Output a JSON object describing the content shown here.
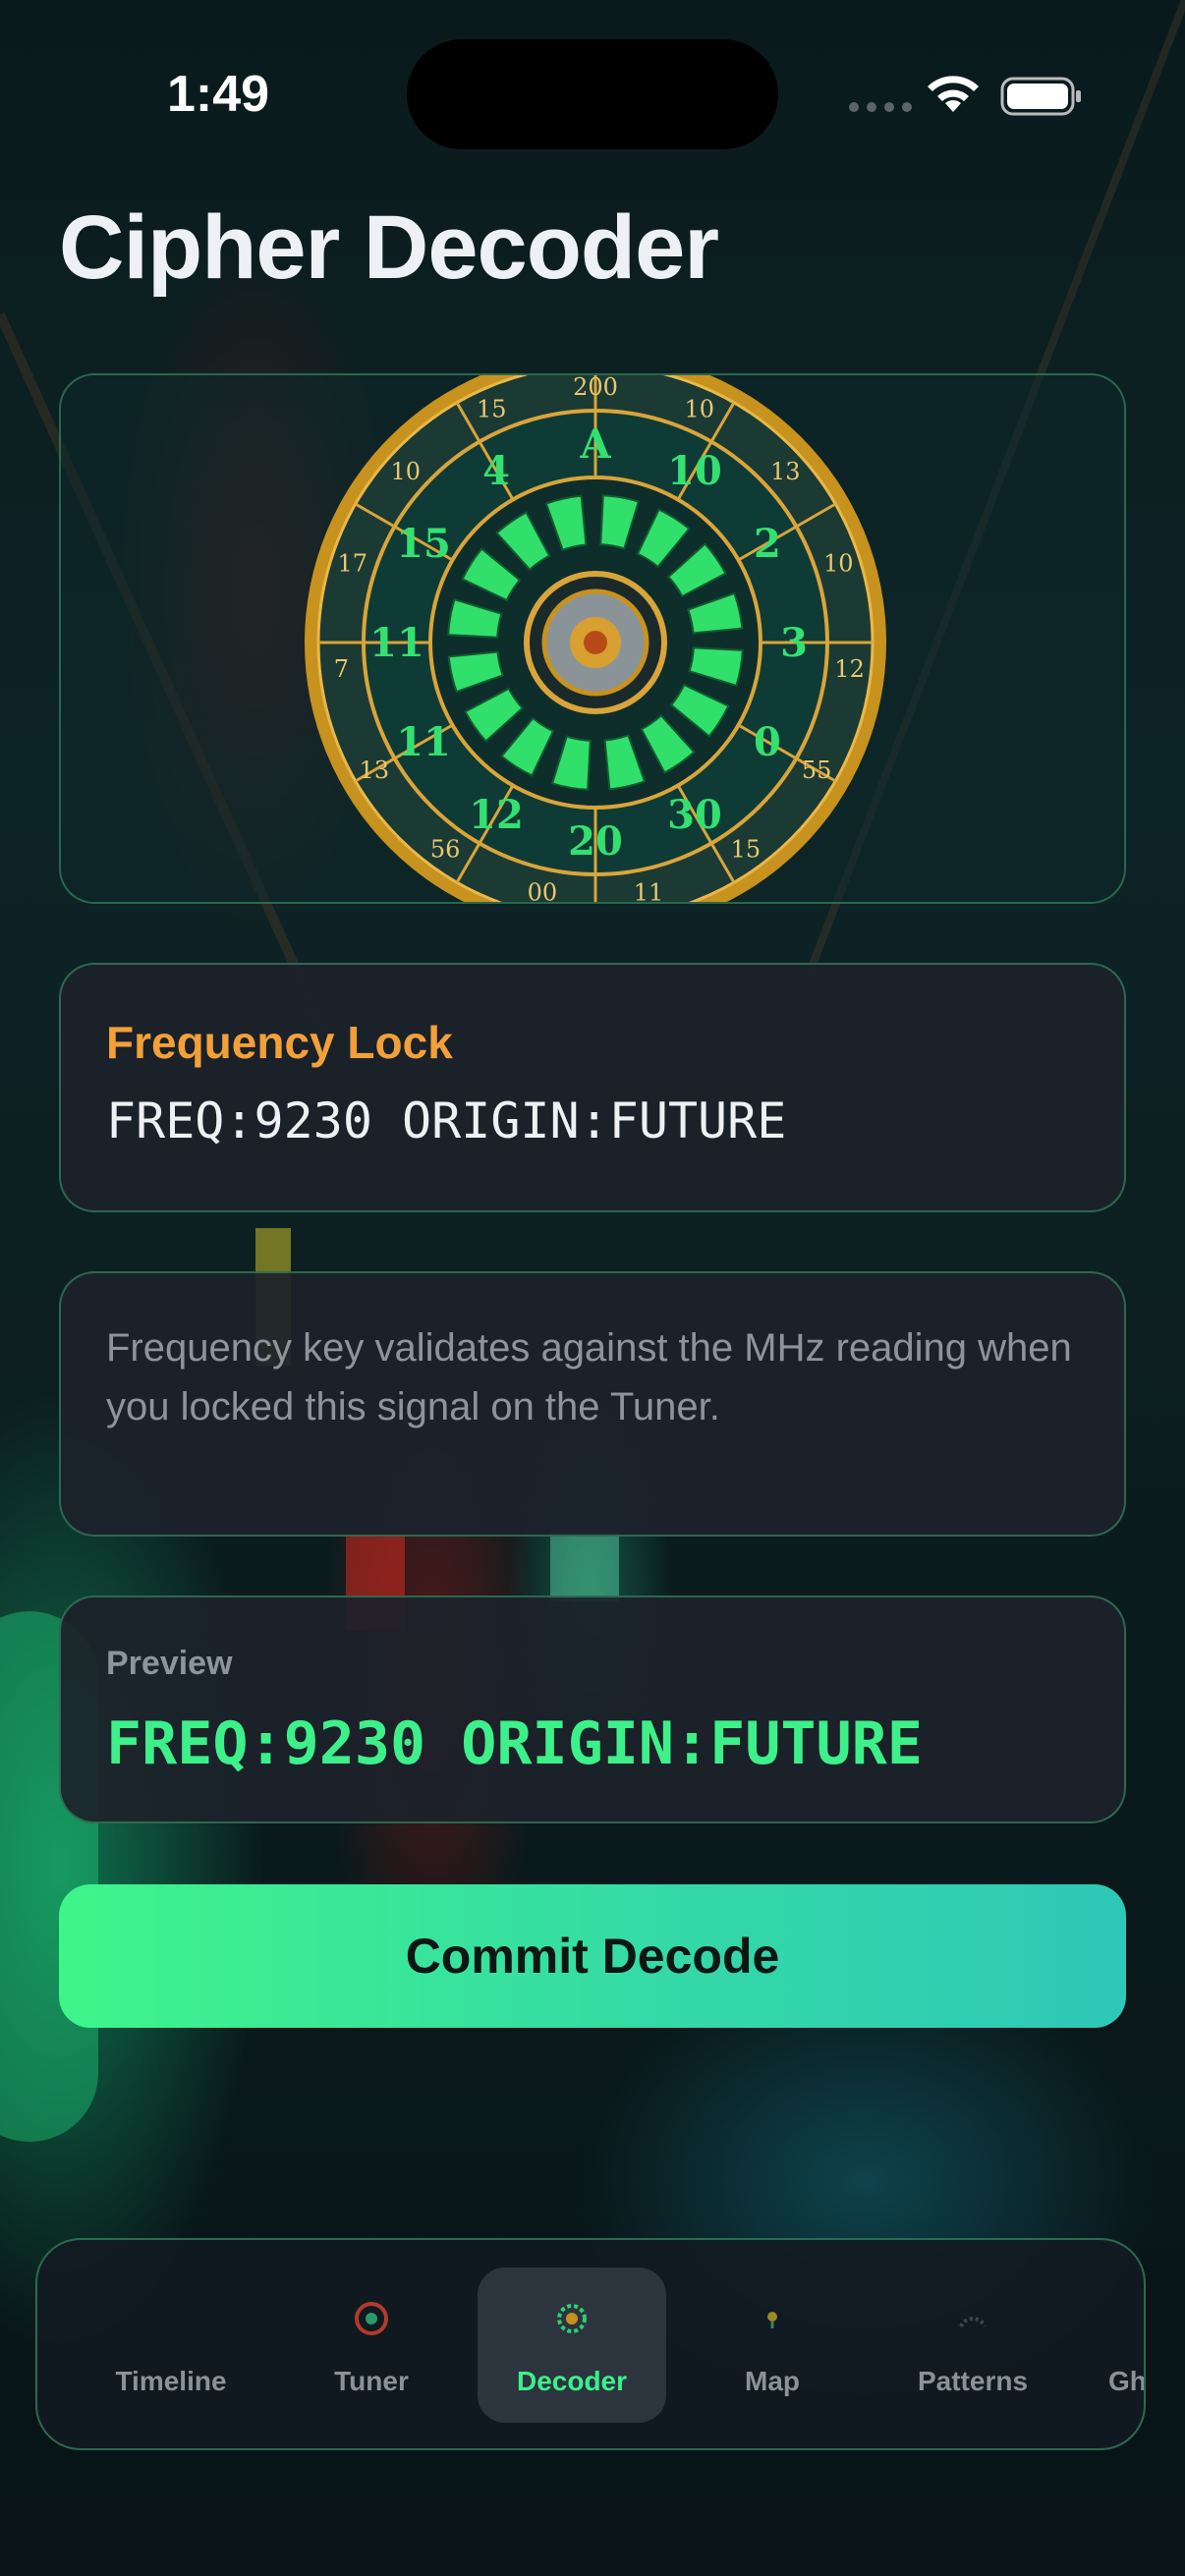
{
  "status_bar": {
    "time": "1:49"
  },
  "page": {
    "title": "Cipher Decoder"
  },
  "dial": {
    "ring_labels": [
      "200",
      "10",
      "13",
      "10",
      "12",
      "55",
      "15",
      "11",
      "00",
      "56",
      "13",
      "7",
      "17",
      "10",
      "15"
    ],
    "inner_labels": [
      "A",
      "10",
      "2",
      "3",
      "0",
      "30",
      "20",
      "12",
      "11",
      "11",
      "15",
      "4"
    ]
  },
  "frequency_lock": {
    "title": "Frequency Lock",
    "value": "FREQ:9230 ORIGIN:FUTURE"
  },
  "info": {
    "text": "Frequency key validates against the MHz reading when you locked this signal on the Tuner."
  },
  "preview": {
    "label": "Preview",
    "value": "FREQ:9230 ORIGIN:FUTURE"
  },
  "actions": {
    "commit_label": "Commit Decode"
  },
  "tabs": [
    {
      "label": "Timeline",
      "icon": "timeline-icon",
      "active": false
    },
    {
      "label": "Tuner",
      "icon": "tuner-icon",
      "active": false
    },
    {
      "label": "Decoder",
      "icon": "decoder-icon",
      "active": true
    },
    {
      "label": "Map",
      "icon": "map-icon",
      "active": false
    },
    {
      "label": "Patterns",
      "icon": "patterns-icon",
      "active": false
    },
    {
      "label": "Ghos",
      "icon": "hourglass-icon",
      "active": false
    }
  ],
  "colors": {
    "accent": "#3df08a",
    "warning": "#f2a03a",
    "border": "#40a06e"
  }
}
